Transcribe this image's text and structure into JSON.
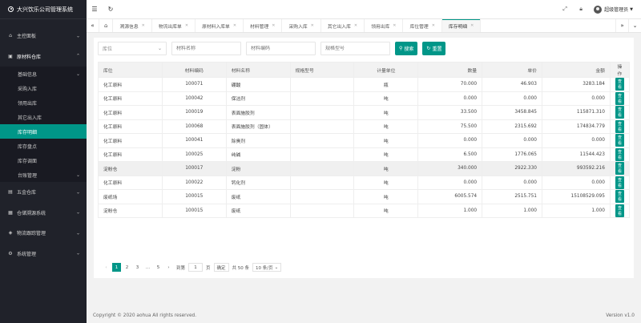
{
  "brand": {
    "title": "大兴饮乐公司管理系统"
  },
  "sidebar": {
    "items": [
      {
        "label": "主控面板",
        "icon": "home-icon"
      },
      {
        "label": "原材料仓库",
        "icon": "box-icon",
        "open": true
      },
      {
        "label": "五金仓库",
        "icon": "tool-icon"
      },
      {
        "label": "仓储溯源系统",
        "icon": "trace-icon"
      },
      {
        "label": "物流跟踪管理",
        "icon": "truck-icon"
      },
      {
        "label": "系统管理",
        "icon": "gear-icon"
      }
    ],
    "submenu": [
      {
        "label": "基础信息",
        "chev": true
      },
      {
        "label": "采购入库"
      },
      {
        "label": "领用出库"
      },
      {
        "label": "其它出入库"
      },
      {
        "label": "库存明细",
        "active": true
      },
      {
        "label": "库存盘点"
      },
      {
        "label": "库存调面"
      },
      {
        "label": "台账管理",
        "chev": true
      }
    ]
  },
  "header": {
    "user": "超级管理员"
  },
  "tabs": [
    "溯源信息",
    "物流出库单",
    "原材料入库单",
    "材料管理",
    "采购入库",
    "其它出入库",
    "领用出库",
    "库位管理",
    "库存明细"
  ],
  "filters": {
    "location_placeholder": "库位",
    "name_placeholder": "材料名称",
    "code_placeholder": "材料编码",
    "spec_placeholder": "规格型号",
    "search_label": "搜索",
    "reset_label": "重置"
  },
  "table": {
    "headers": [
      "库位",
      "材料编码",
      "材料名称",
      "规格型号",
      "计量单位",
      "数量",
      "单价",
      "金额",
      "操作"
    ],
    "action_label": "查看",
    "rows": [
      [
        "化工原料",
        "100071",
        "硼酸",
        "",
        "瓶",
        "70.000",
        "46.903",
        "3283.184"
      ],
      [
        "化工原料",
        "100042",
        "保洁剂",
        "",
        "吨",
        "0.000",
        "0.000",
        "0.000"
      ],
      [
        "化工原料",
        "100019",
        "表面施胶剂",
        "",
        "吨",
        "33.500",
        "3458.845",
        "115871.310"
      ],
      [
        "化工原料",
        "100068",
        "表面施胶剂（固体）",
        "",
        "吨",
        "75.500",
        "2315.692",
        "174834.779"
      ],
      [
        "化工原料",
        "100041",
        "除臭剂",
        "",
        "吨",
        "0.000",
        "0.000",
        "0.000"
      ],
      [
        "化工原料",
        "100025",
        "纯碱",
        "",
        "吨",
        "6.500",
        "1776.065",
        "11544.423"
      ],
      [
        "淀粉仓",
        "100017",
        "淀粉",
        "",
        "吨",
        "340.000",
        "2922.330",
        "993592.216"
      ],
      [
        "化工原料",
        "100022",
        "钙化剂",
        "",
        "吨",
        "0.000",
        "0.000",
        "0.000"
      ],
      [
        "废纸场",
        "100015",
        "废纸",
        "",
        "吨",
        "6005.574",
        "2515.751",
        "15108529.095"
      ],
      [
        "淀粉仓",
        "100015",
        "废纸",
        "",
        "吨",
        "1.000",
        "1.000",
        "1.000"
      ]
    ]
  },
  "pager": {
    "pages": [
      "1",
      "2",
      "3",
      "...",
      "5"
    ],
    "goto_label": "到第",
    "goto_value": "1",
    "page_unit": "页",
    "confirm_label": "确定",
    "total_label": "共 50 条",
    "page_size": "10 条/页"
  },
  "footer": {
    "copyright": "Copyright © 2020 aohua All rights reserved.",
    "version": "Version v1.0"
  }
}
